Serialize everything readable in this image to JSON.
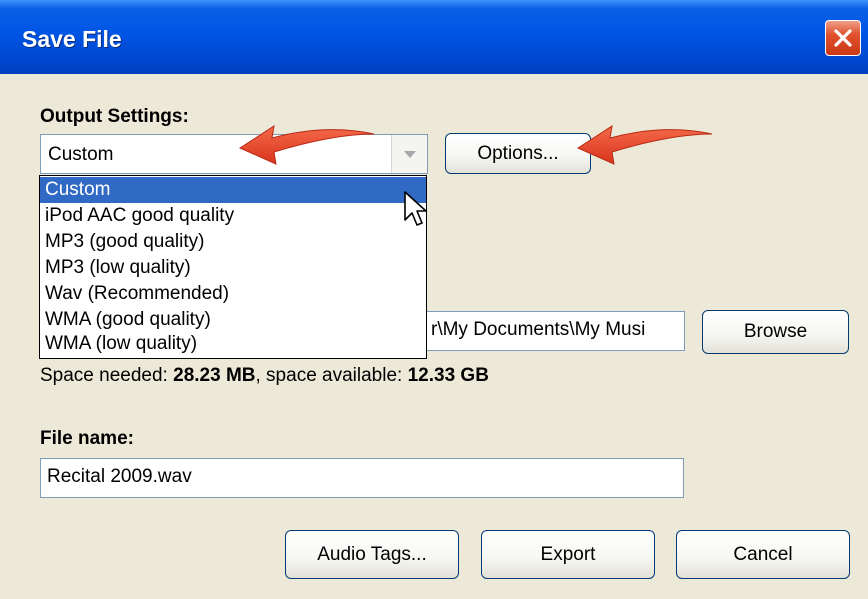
{
  "window": {
    "title": "Save File"
  },
  "output_settings": {
    "label": "Output Settings:",
    "selected": "Custom",
    "options_button": "Options...",
    "dropdown_items": [
      "Custom",
      "iPod AAC good quality",
      "MP3 (good quality)",
      "MP3 (low quality)",
      "Wav (Recommended)",
      "WMA (good quality)",
      "WMA (low quality)"
    ]
  },
  "folder": {
    "path_visible": "r\\My Documents\\My Musi",
    "browse_button": "Browse"
  },
  "space": {
    "needed_label": "Space needed: ",
    "needed_value": "28.23 MB",
    "available_label": ", space available: ",
    "available_value": "12.33 GB"
  },
  "file_name": {
    "label": "File name:",
    "value": "Recital 2009.wav"
  },
  "buttons": {
    "audio_tags": "Audio Tags...",
    "export": "Export",
    "cancel": "Cancel"
  },
  "colors": {
    "title_bar": "#0055e5",
    "dialog_bg": "#ece9d8",
    "selection": "#316ac5",
    "annotation_arrow": "#e8412a"
  }
}
